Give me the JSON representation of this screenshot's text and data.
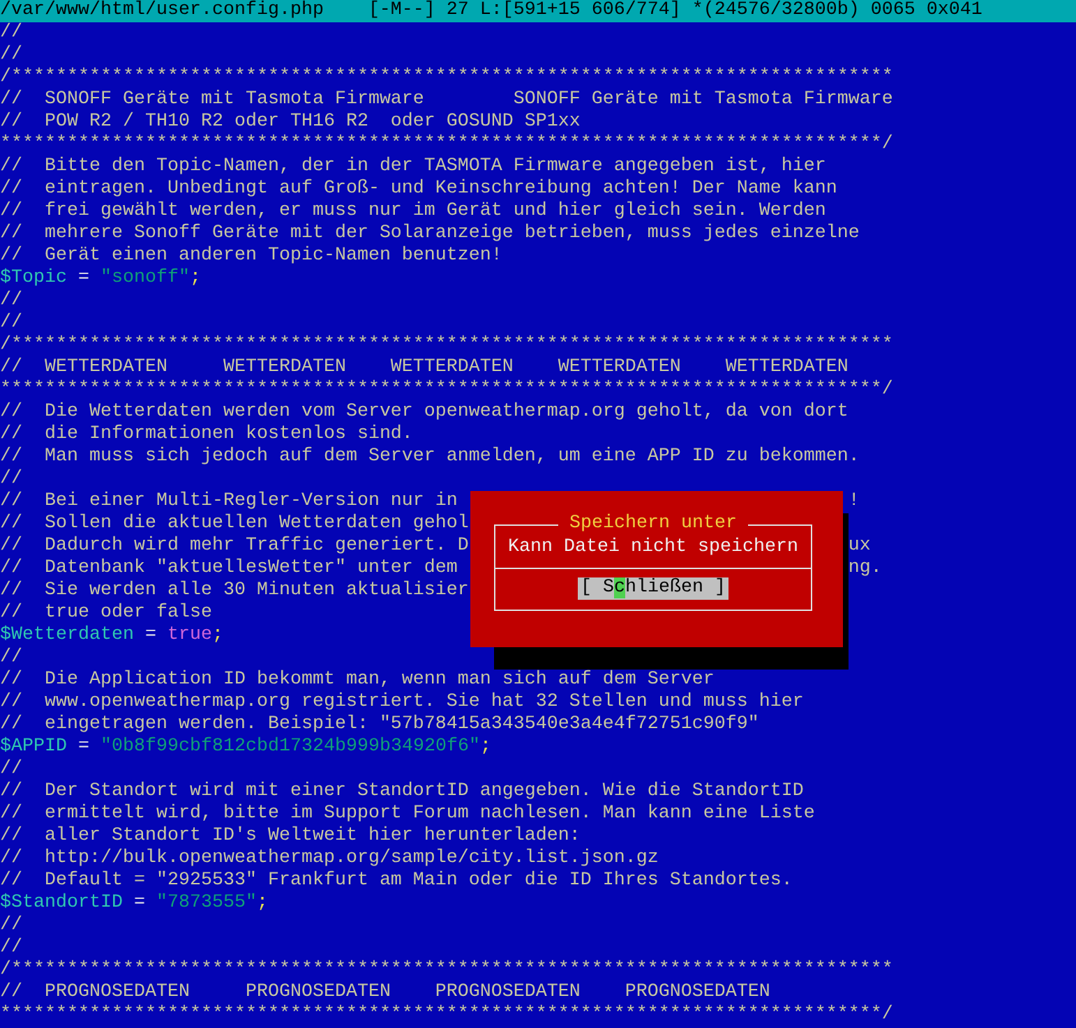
{
  "status_bar": {
    "file": "/var/www/html/user.config.php",
    "info": "[-M--] 27 L:[591+15 606/774] *(24576/32800b) 0065 0x041"
  },
  "lines": [
    {
      "kind": "comment",
      "text": "//"
    },
    {
      "kind": "comment",
      "text": "//"
    },
    {
      "kind": "comment",
      "text": "/*******************************************************************************"
    },
    {
      "kind": "comment",
      "text": "//  SONOFF Geräte mit Tasmota Firmware        SONOFF Geräte mit Tasmota Firmware"
    },
    {
      "kind": "comment",
      "text": "//  POW R2 / TH10 R2 oder TH16 R2  oder GOSUND SP1xx"
    },
    {
      "kind": "comment",
      "text": "*******************************************************************************/"
    },
    {
      "kind": "comment",
      "text": "//  Bitte den Topic-Namen, der in der TASMOTA Firmware angegeben ist, hier"
    },
    {
      "kind": "comment",
      "text": "//  eintragen. Unbedingt auf Groß- und Keinschreibung achten! Der Name kann"
    },
    {
      "kind": "comment",
      "text": "//  frei gewählt werden, er muss nur im Gerät und hier gleich sein. Werden"
    },
    {
      "kind": "comment",
      "text": "//  mehrere Sonoff Geräte mit der Solaranzeige betrieben, muss jedes einzelne"
    },
    {
      "kind": "comment",
      "text": "//  Gerät einen anderen Topic-Namen benutzen!"
    },
    {
      "kind": "assign",
      "var": "$Topic",
      "op": " = ",
      "value": {
        "kind": "string",
        "text": "\"sonoff\""
      },
      "end": ";"
    },
    {
      "kind": "comment",
      "text": "//"
    },
    {
      "kind": "comment",
      "text": "//"
    },
    {
      "kind": "comment",
      "text": "/*******************************************************************************"
    },
    {
      "kind": "comment",
      "text": "//  WETTERDATEN     WETTERDATEN    WETTERDATEN    WETTERDATEN    WETTERDATEN"
    },
    {
      "kind": "comment",
      "text": "*******************************************************************************/"
    },
    {
      "kind": "comment",
      "text": "//  Die Wetterdaten werden vom Server openweathermap.org geholt, da von dort"
    },
    {
      "kind": "comment",
      "text": "//  die Informationen kostenlos sind."
    },
    {
      "kind": "comment",
      "text": "//  Man muss sich jedoch auf dem Server anmelden, um eine APP ID zu bekommen."
    },
    {
      "kind": "comment",
      "text": "//"
    },
    {
      "kind": "comment",
      "text": "//  Bei einer Multi-Regler-Version nur in",
      "tail": "!"
    },
    {
      "kind": "comment",
      "text": "//  Sollen die aktuellen Wetterdaten gehol"
    },
    {
      "kind": "comment",
      "text": "//  Dadurch wird mehr Traffic generiert. D",
      "tail": "ux"
    },
    {
      "kind": "comment",
      "text": "//  Datenbank \"aktuellesWetter\" unter dem",
      "tail": "ng."
    },
    {
      "kind": "comment",
      "text": "//  Sie werden alle 30 Minuten aktualisier"
    },
    {
      "kind": "comment",
      "text": "//  true oder false"
    },
    {
      "kind": "assign",
      "var": "$Wetterdaten",
      "op": " = ",
      "value": {
        "kind": "keyword",
        "text": "true"
      },
      "end": ";"
    },
    {
      "kind": "comment",
      "text": "//"
    },
    {
      "kind": "comment",
      "text": "//  Die Application ID bekommt man, wenn man sich auf dem Server"
    },
    {
      "kind": "comment",
      "text": "//  www.openweathermap.org registriert. Sie hat 32 Stellen und muss hier"
    },
    {
      "kind": "comment",
      "text": "//  eingetragen werden. Beispiel: \"57b78415a343540e3a4e4f72751c90f9\""
    },
    {
      "kind": "assign",
      "var": "$APPID",
      "op": " = ",
      "value": {
        "kind": "string",
        "text": "\"0b8f99cbf812cbd17324b999b34920f6\""
      },
      "end": ";"
    },
    {
      "kind": "comment",
      "text": "//"
    },
    {
      "kind": "comment",
      "text": "//  Der Standort wird mit einer StandortID angegeben. Wie die StandortID"
    },
    {
      "kind": "comment",
      "text": "//  ermittelt wird, bitte im Support Forum nachlesen. Man kann eine Liste"
    },
    {
      "kind": "comment",
      "text": "//  aller Standort ID's Weltweit hier herunterladen:"
    },
    {
      "kind": "comment",
      "text": "//  http://bulk.openweathermap.org/sample/city.list.json.gz"
    },
    {
      "kind": "comment",
      "text": "//  Default = \"2925533\" Frankfurt am Main oder die ID Ihres Standortes."
    },
    {
      "kind": "assign",
      "var": "$StandortID",
      "op": " = ",
      "value": {
        "kind": "string",
        "text": "\"7873555\""
      },
      "end": ";"
    },
    {
      "kind": "comment",
      "text": "//"
    },
    {
      "kind": "comment",
      "text": "//"
    },
    {
      "kind": "comment",
      "text": "/*******************************************************************************"
    },
    {
      "kind": "comment",
      "text": "//  PROGNOSEDATEN     PROGNOSEDATEN    PROGNOSEDATEN    PROGNOSEDATEN"
    },
    {
      "kind": "comment",
      "text": "*******************************************************************************/"
    }
  ],
  "dialog": {
    "title": "Speichern unter",
    "message": "Kann Datei nicht speichern",
    "button": {
      "before": "[ S",
      "cursor": "c",
      "after": "hließen ]"
    }
  }
}
